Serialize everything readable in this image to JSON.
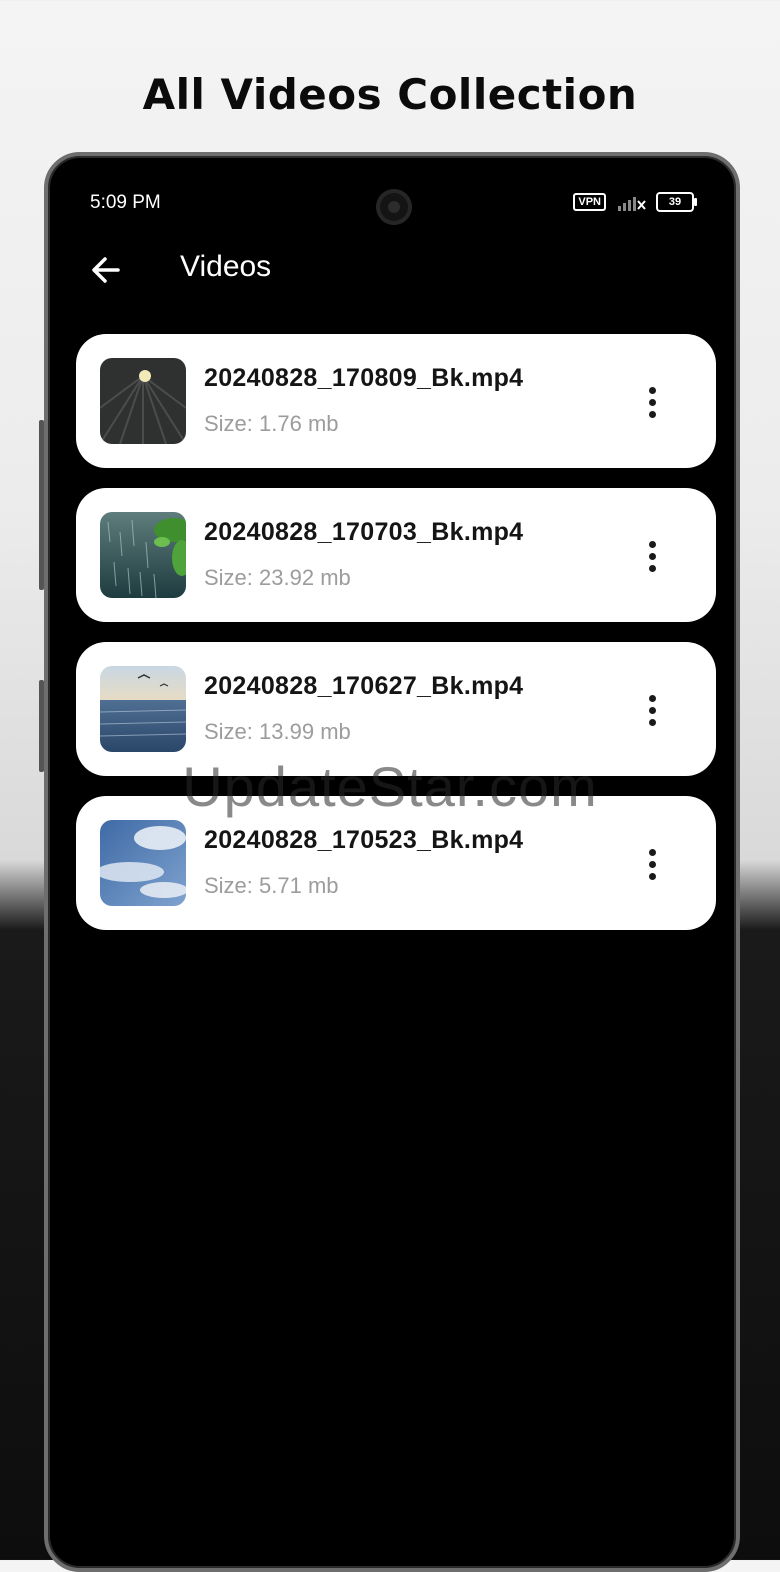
{
  "promo": {
    "title": "All Videos Collection"
  },
  "status_bar": {
    "time": "5:09 PM",
    "vpn_label": "VPN",
    "battery_level": "39"
  },
  "app_bar": {
    "back_icon": "arrow-left-icon",
    "title": "Videos"
  },
  "videos": [
    {
      "name": "20240828_170809_Bk.mp4",
      "size": "Size: 1.76 mb",
      "thumbnail": "dark-night-rain-moon"
    },
    {
      "name": "20240828_170703_Bk.mp4",
      "size": "Size: 23.92 mb",
      "thumbnail": "rain-with-green-leaves"
    },
    {
      "name": "20240828_170627_Bk.mp4",
      "size": "Size: 13.99 mb",
      "thumbnail": "sea-with-seagulls"
    },
    {
      "name": "20240828_170523_Bk.mp4",
      "size": "Size: 5.71 mb",
      "thumbnail": "blue-sky-with-clouds"
    }
  ],
  "watermark": "UpdateStar.com"
}
